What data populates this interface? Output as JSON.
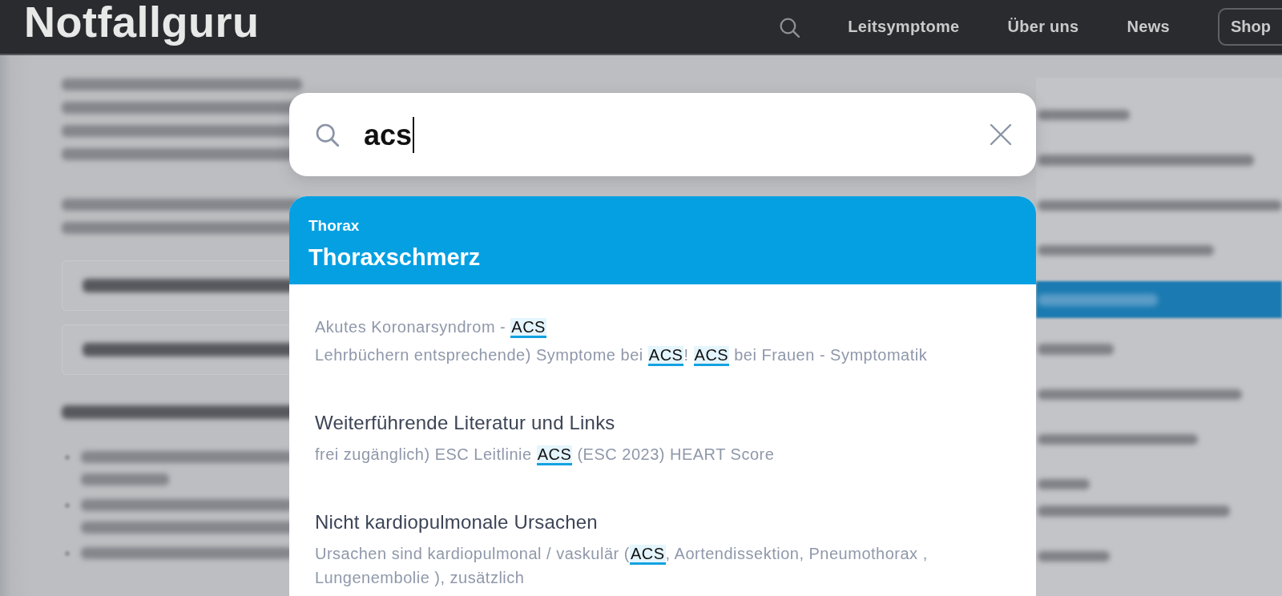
{
  "site_header": {
    "logo": "Notfallguru",
    "nav": [
      {
        "label": "Leitsymptome",
        "kind": "link"
      },
      {
        "label": "Über uns",
        "kind": "link"
      },
      {
        "label": "News",
        "kind": "link"
      },
      {
        "label": "Shop",
        "kind": "button"
      }
    ]
  },
  "search": {
    "value": "acs"
  },
  "results": {
    "category": "Thorax",
    "title": "Thoraxschmerz",
    "items": [
      {
        "excerpts": [
          [
            {
              "text": "Akutes Koronarsyndrom - "
            },
            {
              "text": "ACS",
              "highlight": true
            }
          ],
          [
            {
              "text": "Lehrbüchern entsprechende) Symptome bei "
            },
            {
              "text": "ACS",
              "highlight": true
            },
            {
              "text": "! "
            },
            {
              "text": "ACS",
              "highlight": true
            },
            {
              "text": " bei Frauen - Symptomatik"
            }
          ]
        ]
      },
      {
        "title": "Weiterführende Literatur und Links",
        "excerpts": [
          [
            {
              "text": "frei zugänglich) ESC Leitlinie "
            },
            {
              "text": "ACS",
              "highlight": true
            },
            {
              "text": " (ESC 2023) HEART Score"
            }
          ]
        ]
      },
      {
        "title": "Nicht kardiopulmonale Ursachen",
        "excerpts": [
          [
            {
              "text": "Ursachen sind kardiopulmonal / vaskulär ("
            },
            {
              "text": "ACS",
              "highlight": true
            },
            {
              "text": ", Aortendissektion, Pneumothorax , Lungenembolie ), zusätzlich"
            }
          ]
        ]
      }
    ]
  }
}
